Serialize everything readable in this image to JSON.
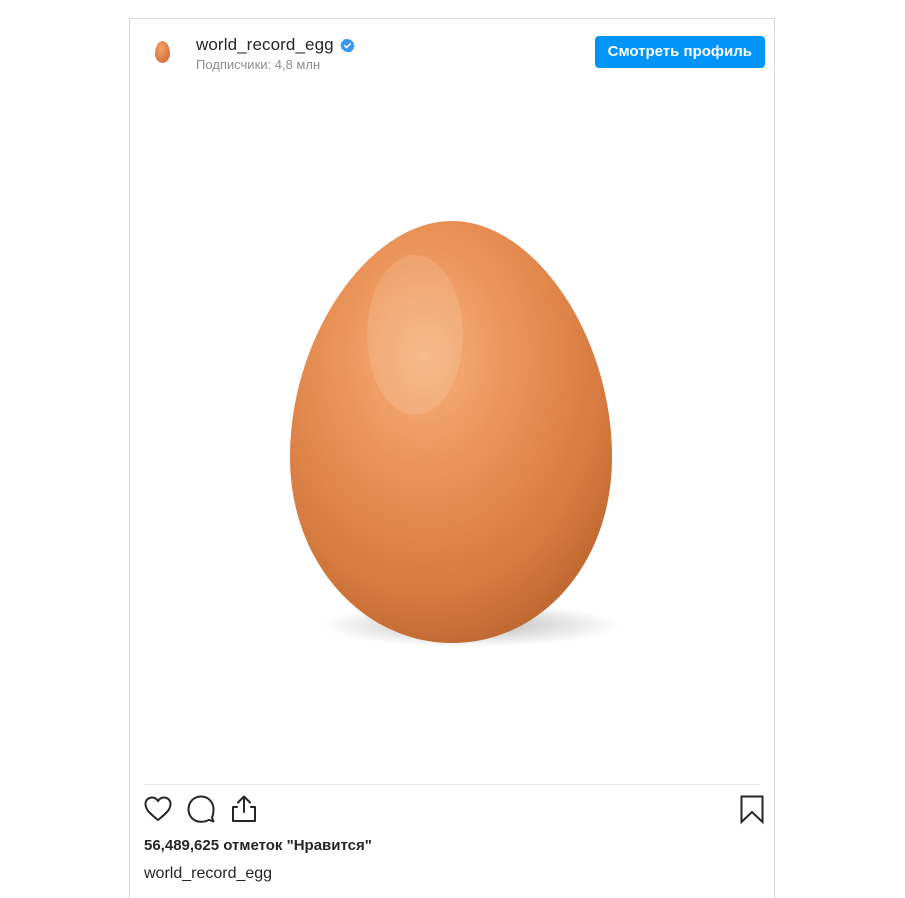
{
  "post": {
    "username": "world_record_egg",
    "followers_text": "Подписчики: 4,8 млн",
    "view_profile_label": "Смотреть профиль",
    "likes_text": "56,489,625 отметок \"Нравится\"",
    "caption_username": "world_record_egg"
  },
  "icons": {
    "verified": "verified-badge-icon",
    "like": "heart-icon",
    "comment": "comment-bubble-icon",
    "share": "share-upload-icon",
    "save": "bookmark-icon"
  },
  "colors": {
    "accent": "#0095f6",
    "verified": "#3897f0",
    "text": "#262626",
    "muted": "#8e8e8e",
    "egg": "#dc7f44"
  }
}
